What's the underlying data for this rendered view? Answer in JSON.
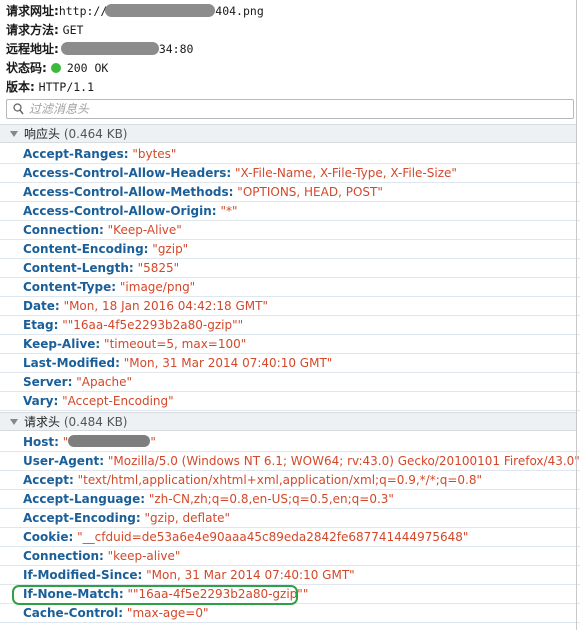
{
  "summary": {
    "request_url_label": "请求网址:",
    "request_url_prefix": "http://",
    "request_url_suffix": "404.png",
    "request_method_label": "请求方法:",
    "request_method": "GET",
    "remote_address_label": "远程地址:",
    "remote_address_suffix": "34:80",
    "status_code_label": "状态码:",
    "status_code": "200 OK",
    "status_color": "#3cb83c",
    "version_label": "版本:",
    "version": "HTTP/1.1"
  },
  "filter": {
    "placeholder": "过滤消息头",
    "icon": "search-icon"
  },
  "response_headers": {
    "title": "响应头",
    "size": "(0.464 KB)",
    "rows": [
      {
        "name": "Accept-Ranges:",
        "value": "\"bytes\""
      },
      {
        "name": "Access-Control-Allow-Headers:",
        "value": "\"X-File-Name, X-File-Type, X-File-Size\""
      },
      {
        "name": "Access-Control-Allow-Methods:",
        "value": "\"OPTIONS, HEAD, POST\""
      },
      {
        "name": "Access-Control-Allow-Origin:",
        "value": "\"*\""
      },
      {
        "name": "Connection:",
        "value": "\"Keep-Alive\""
      },
      {
        "name": "Content-Encoding:",
        "value": "\"gzip\""
      },
      {
        "name": "Content-Length:",
        "value": "\"5825\""
      },
      {
        "name": "Content-Type:",
        "value": "\"image/png\""
      },
      {
        "name": "Date:",
        "value": "\"Mon, 18 Jan 2016 04:42:18 GMT\""
      },
      {
        "name": "Etag:",
        "value": "\"\"16aa-4f5e2293b2a80-gzip\"\""
      },
      {
        "name": "Keep-Alive:",
        "value": "\"timeout=5, max=100\""
      },
      {
        "name": "Last-Modified:",
        "value": "\"Mon, 31 Mar 2014 07:40:10 GMT\""
      },
      {
        "name": "Server:",
        "value": "\"Apache\""
      },
      {
        "name": "Vary:",
        "value": "\"Accept-Encoding\""
      }
    ]
  },
  "request_headers": {
    "title": "请求头",
    "size": "(0.484 KB)",
    "host": {
      "name": "Host:",
      "value_open": "\"",
      "value_close": "\""
    },
    "rows": [
      {
        "name": "User-Agent:",
        "value": "\"Mozilla/5.0 (Windows NT 6.1; WOW64; rv:43.0) Gecko/20100101 Firefox/43.0\""
      },
      {
        "name": "Accept:",
        "value": "\"text/html,application/xhtml+xml,application/xml;q=0.9,*/*;q=0.8\""
      },
      {
        "name": "Accept-Language:",
        "value": "\"zh-CN,zh;q=0.8,en-US;q=0.5,en;q=0.3\""
      },
      {
        "name": "Accept-Encoding:",
        "value": "\"gzip, deflate\""
      },
      {
        "name": "Cookie:",
        "value": "\"__cfduid=de53a6e4e90aaa45c89eda2842fe687741444975648\""
      },
      {
        "name": "Connection:",
        "value": "\"keep-alive\""
      },
      {
        "name": "If-Modified-Since:",
        "value": "\"Mon, 31 Mar 2014 07:40:10 GMT\""
      },
      {
        "name": "If-None-Match:",
        "value": "\"\"16aa-4f5e2293b2a80-gzip\"\""
      },
      {
        "name": "Cache-Control:",
        "value": "\"max-age=0\""
      }
    ]
  },
  "colors": {
    "header_name": "#1a5f99",
    "header_value": "#d3482a",
    "highlight": "#2fa043"
  }
}
